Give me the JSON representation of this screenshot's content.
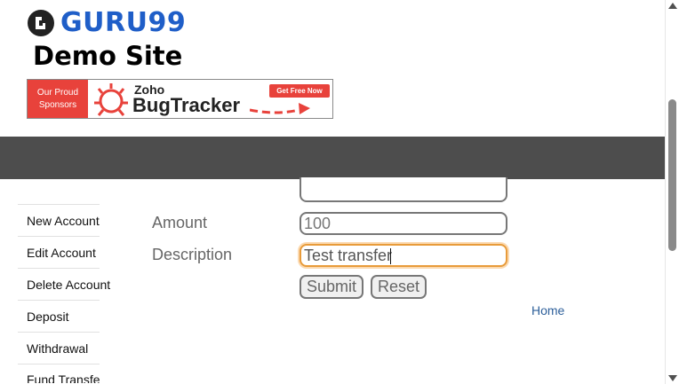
{
  "logo": {
    "text": "GURU99"
  },
  "site_title": "Demo Site",
  "banner": {
    "left_text": "Our Proud Sponsors",
    "brand_top": "Zoho",
    "brand_main": "BugTracker",
    "cta": "Get Free Now"
  },
  "sidebar": {
    "items": [
      {
        "label": "New Account"
      },
      {
        "label": "Edit Account"
      },
      {
        "label": "Delete Account"
      },
      {
        "label": "Deposit"
      },
      {
        "label": "Withdrawal"
      },
      {
        "label": "Fund Transfer"
      }
    ]
  },
  "form": {
    "amount_label": "Amount",
    "amount_value": "100",
    "description_label": "Description",
    "description_value": "Test transfer",
    "submit_label": "Submit",
    "reset_label": "Reset"
  },
  "home_link": "Home",
  "colors": {
    "brand_blue": "#1f5ec8",
    "nav_bg": "#4d4d4d",
    "focus": "#e89b3a"
  }
}
